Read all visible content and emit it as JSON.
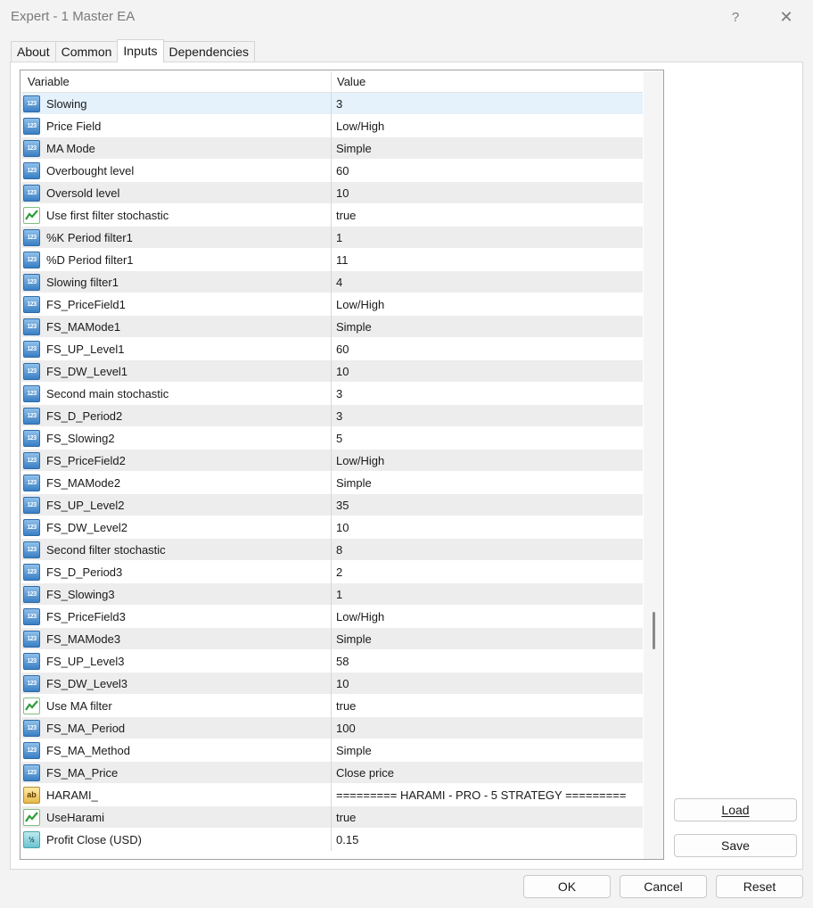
{
  "window": {
    "title": "Expert - 1 Master EA",
    "help_glyph": "?",
    "close_glyph": "✕"
  },
  "tabs": [
    {
      "label": "About"
    },
    {
      "label": "Common"
    },
    {
      "label": "Inputs",
      "active": true
    },
    {
      "label": "Dependencies"
    }
  ],
  "grid": {
    "columns": [
      "Variable",
      "Value"
    ],
    "rows": [
      {
        "icon": "int",
        "variable": "Slowing",
        "value": "3"
      },
      {
        "icon": "int",
        "variable": "Price Field",
        "value": "Low/High"
      },
      {
        "icon": "int",
        "variable": "MA Mode",
        "value": "Simple"
      },
      {
        "icon": "int",
        "variable": "Overbought level",
        "value": "60"
      },
      {
        "icon": "int",
        "variable": "Oversold level",
        "value": "10"
      },
      {
        "icon": "bool",
        "variable": "Use first filter stochastic",
        "value": "true"
      },
      {
        "icon": "int",
        "variable": "%K Period filter1",
        "value": "1"
      },
      {
        "icon": "int",
        "variable": "%D Period filter1",
        "value": "11"
      },
      {
        "icon": "int",
        "variable": "Slowing filter1",
        "value": "4"
      },
      {
        "icon": "int",
        "variable": "FS_PriceField1",
        "value": "Low/High"
      },
      {
        "icon": "int",
        "variable": "FS_MAMode1",
        "value": "Simple"
      },
      {
        "icon": "int",
        "variable": "FS_UP_Level1",
        "value": "60"
      },
      {
        "icon": "int",
        "variable": "FS_DW_Level1",
        "value": "10"
      },
      {
        "icon": "int",
        "variable": "Second main stochastic",
        "value": "3"
      },
      {
        "icon": "int",
        "variable": "FS_D_Period2",
        "value": "3"
      },
      {
        "icon": "int",
        "variable": "FS_Slowing2",
        "value": "5"
      },
      {
        "icon": "int",
        "variable": "FS_PriceField2",
        "value": "Low/High"
      },
      {
        "icon": "int",
        "variable": "FS_MAMode2",
        "value": "Simple"
      },
      {
        "icon": "int",
        "variable": "FS_UP_Level2",
        "value": "35"
      },
      {
        "icon": "int",
        "variable": "FS_DW_Level2",
        "value": "10"
      },
      {
        "icon": "int",
        "variable": "Second filter stochastic",
        "value": "8"
      },
      {
        "icon": "int",
        "variable": "FS_D_Period3",
        "value": "2"
      },
      {
        "icon": "int",
        "variable": "FS_Slowing3",
        "value": "1"
      },
      {
        "icon": "int",
        "variable": "FS_PriceField3",
        "value": "Low/High"
      },
      {
        "icon": "int",
        "variable": "FS_MAMode3",
        "value": "Simple"
      },
      {
        "icon": "int",
        "variable": "FS_UP_Level3",
        "value": "58"
      },
      {
        "icon": "int",
        "variable": "FS_DW_Level3",
        "value": "10"
      },
      {
        "icon": "bool",
        "variable": "Use MA filter",
        "value": "true"
      },
      {
        "icon": "int",
        "variable": "FS_MA_Period",
        "value": "100"
      },
      {
        "icon": "int",
        "variable": "FS_MA_Method",
        "value": "Simple"
      },
      {
        "icon": "int",
        "variable": "FS_MA_Price",
        "value": "Close price"
      },
      {
        "icon": "str",
        "variable": "HARAMI_",
        "value": "========= HARAMI - PRO - 5 STRATEGY ========="
      },
      {
        "icon": "bool",
        "variable": "UseHarami",
        "value": "true"
      },
      {
        "icon": "dbl",
        "variable": "Profit Close (USD)",
        "value": "0.15"
      }
    ]
  },
  "icon_glyphs": {
    "int": "123",
    "str": "ab",
    "dbl": "½"
  },
  "buttons": {
    "load": "Load",
    "save": "Save",
    "ok": "OK",
    "cancel": "Cancel",
    "reset": "Reset"
  },
  "colors": {
    "selected_row": "#e5f1fb",
    "alt_row": "#ededed",
    "int_icon": "#3a7fc4",
    "bool_icon": "#2e9e3a"
  }
}
